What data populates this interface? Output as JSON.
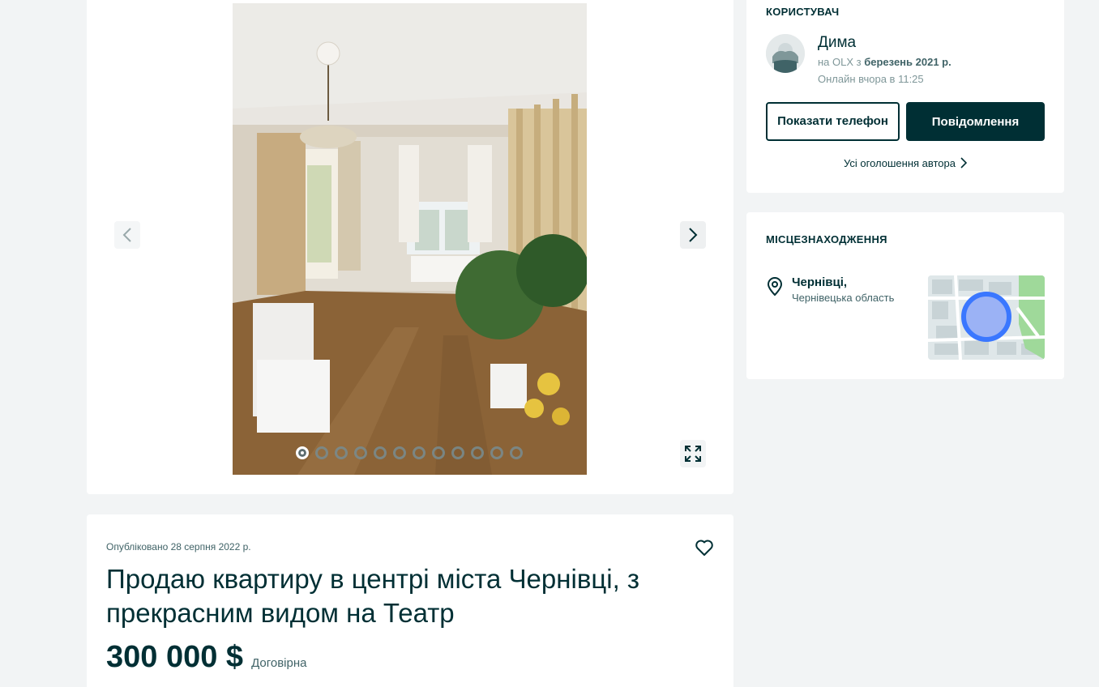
{
  "gallery": {
    "dots_count": 12,
    "active_dot": 1
  },
  "ad": {
    "published": "Опубліковано 28 серпня 2022 р.",
    "title": "Продаю квартиру в центрі міста Чернівці, з прекрасним видом на Театр",
    "price": "300 000 $",
    "price_note": "Договірна"
  },
  "user": {
    "heading": "КОРИСТУВАЧ",
    "name": "Дима",
    "since_prefix": "на OLX з ",
    "since_date": "березень 2021 р.",
    "online": "Онлайн вчора в 11:25",
    "show_phone_label": "Показати телефон",
    "message_label": "Повідомлення",
    "all_ads_label": "Усі оголошення автора"
  },
  "location": {
    "heading": "МІСЦЕЗНАХОДЖЕННЯ",
    "city": "Чернівці,",
    "region": "Чернівецька область"
  },
  "colors": {
    "primary": "#002f34",
    "background": "#f2f4f5",
    "map_marker": "#3a77ff",
    "map_park": "#9fd99a"
  },
  "icons": [
    "chevron-left-icon",
    "chevron-right-icon",
    "fullscreen-icon",
    "heart-icon",
    "location-pin-icon",
    "chevron-right-small-icon"
  ]
}
